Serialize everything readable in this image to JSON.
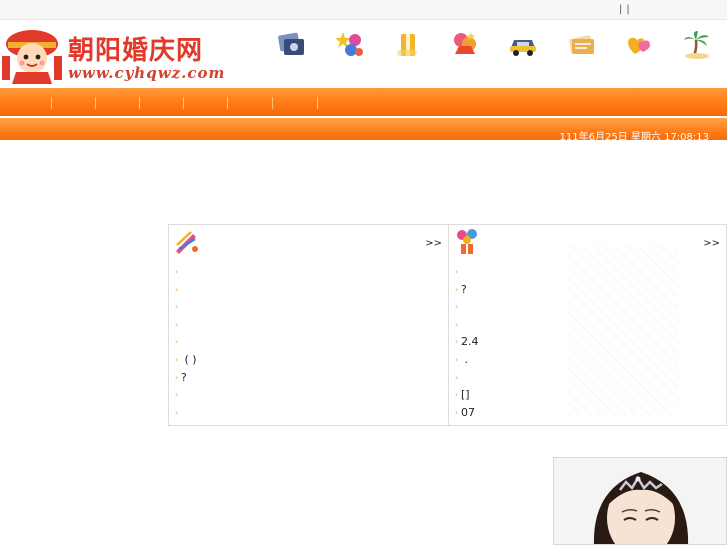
{
  "topbar": {
    "left_glyph": "",
    "links": [
      "",
      "",
      ""
    ]
  },
  "header": {
    "brand": "朝阳婚庆网",
    "url": "www.cyhqwz.com",
    "categories": [
      {
        "label": "",
        "icon": "camera-photos-icon",
        "color": "#6a7fb0"
      },
      {
        "label": "",
        "icon": "balloons-stars-icon",
        "color": "#d84a9a"
      },
      {
        "label": "",
        "icon": "gift-box-icon",
        "color": "#f0b020"
      },
      {
        "label": "",
        "icon": "wedding-cake-icon",
        "color": "#e8603c"
      },
      {
        "label": "",
        "icon": "wedding-car-icon",
        "color": "#4a5a8a"
      },
      {
        "label": "",
        "icon": "invitation-card-icon",
        "color": "#e0a840"
      },
      {
        "label": "",
        "icon": "heart-rings-icon",
        "color": "#f0c020"
      },
      {
        "label": "",
        "icon": "palm-island-icon",
        "color": "#3aa050"
      }
    ]
  },
  "nav": {
    "items": [
      "",
      "",
      "",
      "",
      "",
      "",
      "",
      ""
    ]
  },
  "subbar": {
    "date": "111年6月25日 星期六 17:08:13"
  },
  "panel1": {
    "title": "",
    "more": ">>",
    "icon": "pencil-brush-icon",
    "items": [
      "",
      "",
      "",
      "",
      "",
      " (  )",
      "?",
      "",
      ""
    ]
  },
  "panel2": {
    "title": "",
    "more": ">>",
    "icon": "gift-balloons-icon",
    "items": [
      "",
      "?",
      "",
      "",
      "2.4",
      " .",
      "",
      "[]",
      "07"
    ]
  }
}
